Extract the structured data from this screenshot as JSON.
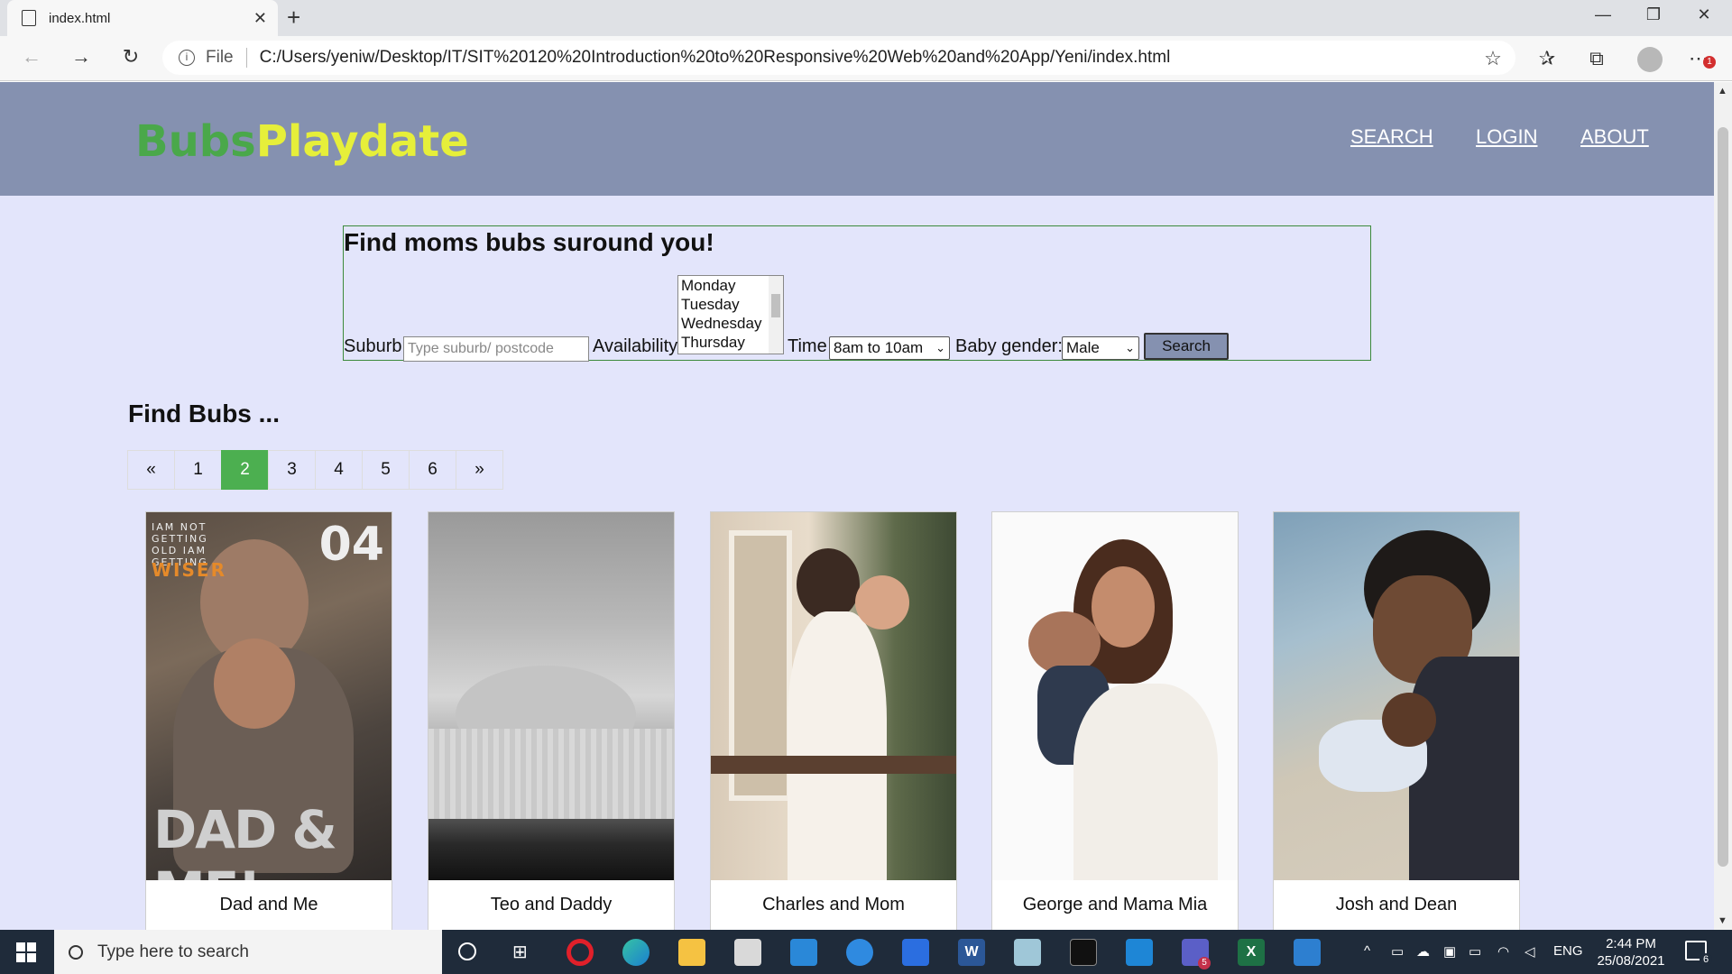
{
  "browser": {
    "tab_title": "index.html",
    "new_tab_symbol": "+",
    "close_symbol": "✕",
    "file_label": "File",
    "url": "C:/Users/yeniw/Desktop/IT/SIT%20120%20Introduction%20to%20Responsive%20Web%20and%20App/Yeni/index.html",
    "notification_badge": "1"
  },
  "header": {
    "logo_part1": "Bubs",
    "logo_part2": "Playdate",
    "nav": [
      "SEARCH",
      "LOGIN",
      "ABOUT"
    ]
  },
  "search": {
    "heading": "Find moms bubs suround you!",
    "suburb_label": "Suburb",
    "suburb_placeholder": "Type suburb/ postcode",
    "availability_label": "Availability",
    "days": [
      "Monday",
      "Tuesday",
      "Wednesday",
      "Thursday"
    ],
    "time_label": "Time",
    "time_value": "8am to 10am",
    "gender_label": "Baby gender:",
    "gender_value": "Male",
    "button": "Search"
  },
  "listing": {
    "heading": "Find Bubs ...",
    "pages": [
      "«",
      "1",
      "2",
      "3",
      "4",
      "5",
      "6",
      "»"
    ],
    "active_page": "2",
    "cards": [
      {
        "caption": "Dad and Me",
        "photo_text_1": "IAM NOT GETTING OLD IAM GETTING",
        "photo_text_2": "WISER",
        "photo_number": "04",
        "photo_title": "DAD & ME!"
      },
      {
        "caption": "Teo and Daddy"
      },
      {
        "caption": "Charles and Mom"
      },
      {
        "caption": "George and Mama Mia"
      },
      {
        "caption": "Josh and Dean"
      }
    ]
  },
  "taskbar": {
    "search_placeholder": "Type here to search",
    "language": "ENG",
    "time": "2:44 PM",
    "date": "25/08/2021",
    "notifications": "6",
    "teams_badge": "5"
  },
  "colors": {
    "header_bg": "#8591b0",
    "page_bg": "#e3e5fb",
    "logo_green": "#4aa84a",
    "logo_yellow": "#e6ef3a",
    "active_page": "#4caf50"
  }
}
